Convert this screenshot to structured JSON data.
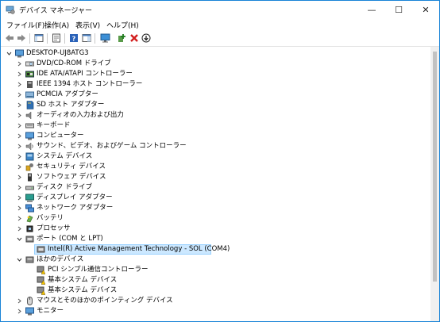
{
  "window": {
    "title": "デバイス マネージャー",
    "minimize_glyph": "—",
    "maximize_glyph": "☐",
    "close_glyph": "✕"
  },
  "menu": [
    {
      "label": "ファイル(F)"
    },
    {
      "label": "操作(A)"
    },
    {
      "label": "表示(V)"
    },
    {
      "label": "ヘルプ(H)"
    }
  ],
  "toolbar": [
    {
      "icon": "back-arrow-icon"
    },
    {
      "icon": "forward-arrow-icon"
    },
    {
      "icon": "show-hide-console-tree-icon"
    },
    {
      "icon": "properties-icon"
    },
    {
      "icon": "help-icon"
    },
    {
      "icon": "action-pane-icon"
    },
    {
      "icon": "monitor-scan-icon"
    },
    {
      "icon": "add-driver-icon"
    },
    {
      "icon": "uninstall-device-icon"
    },
    {
      "icon": "update-driver-icon"
    }
  ],
  "tree": {
    "root": {
      "label": "DESKTOP-UJ8ATG3",
      "expanded": true,
      "icon": "computer-icon"
    },
    "categories": [
      {
        "label": "DVD/CD-ROM ドライブ",
        "icon": "dvd-drive-icon",
        "expanded": false
      },
      {
        "label": "IDE ATA/ATAPI コントローラー",
        "icon": "ide-controller-icon",
        "expanded": false
      },
      {
        "label": "IEEE 1394 ホスト コントローラー",
        "icon": "ieee1394-icon",
        "expanded": false
      },
      {
        "label": "PCMCIA アダプター",
        "icon": "pcmcia-icon",
        "expanded": false
      },
      {
        "label": "SD ホスト アダプター",
        "icon": "sd-host-icon",
        "expanded": false
      },
      {
        "label": "オーディオの入力および出力",
        "icon": "audio-icon",
        "expanded": false
      },
      {
        "label": "キーボード",
        "icon": "keyboard-icon",
        "expanded": false
      },
      {
        "label": "コンピューター",
        "icon": "computer-icon",
        "expanded": false
      },
      {
        "label": "サウンド、ビデオ、およびゲーム コントローラー",
        "icon": "sound-icon",
        "expanded": false
      },
      {
        "label": "システム デバイス",
        "icon": "system-device-icon",
        "expanded": false
      },
      {
        "label": "セキュリティ デバイス",
        "icon": "security-icon",
        "expanded": false
      },
      {
        "label": "ソフトウェア デバイス",
        "icon": "software-device-icon",
        "expanded": false
      },
      {
        "label": "ディスク ドライブ",
        "icon": "disk-drive-icon",
        "expanded": false
      },
      {
        "label": "ディスプレイ アダプター",
        "icon": "display-adapter-icon",
        "expanded": false
      },
      {
        "label": "ネットワーク アダプター",
        "icon": "network-adapter-icon",
        "expanded": false
      },
      {
        "label": "バッテリ",
        "icon": "battery-icon",
        "expanded": false
      },
      {
        "label": "プロセッサ",
        "icon": "processor-icon",
        "expanded": false
      },
      {
        "label": "ポート (COM と LPT)",
        "icon": "port-icon",
        "expanded": true,
        "children": [
          {
            "label": "Intel(R) Active Management Technology - SOL (COM4)",
            "icon": "port-icon",
            "selected": true
          }
        ]
      },
      {
        "label": "ほかのデバイス",
        "icon": "other-device-icon",
        "expanded": true,
        "children": [
          {
            "label": "PCI シンプル通信コントローラー",
            "icon": "warning-device-icon"
          },
          {
            "label": "基本システム デバイス",
            "icon": "warning-device-icon"
          },
          {
            "label": "基本システム デバイス",
            "icon": "warning-device-icon"
          }
        ]
      },
      {
        "label": "マウスとそのほかのポインティング デバイス",
        "icon": "mouse-icon",
        "expanded": false
      },
      {
        "label": "モニター",
        "icon": "monitor-icon",
        "expanded": false
      }
    ]
  },
  "colors": {
    "selection": "#cce8ff",
    "selection_border": "#99d1ff",
    "accent": "#1883d7"
  }
}
